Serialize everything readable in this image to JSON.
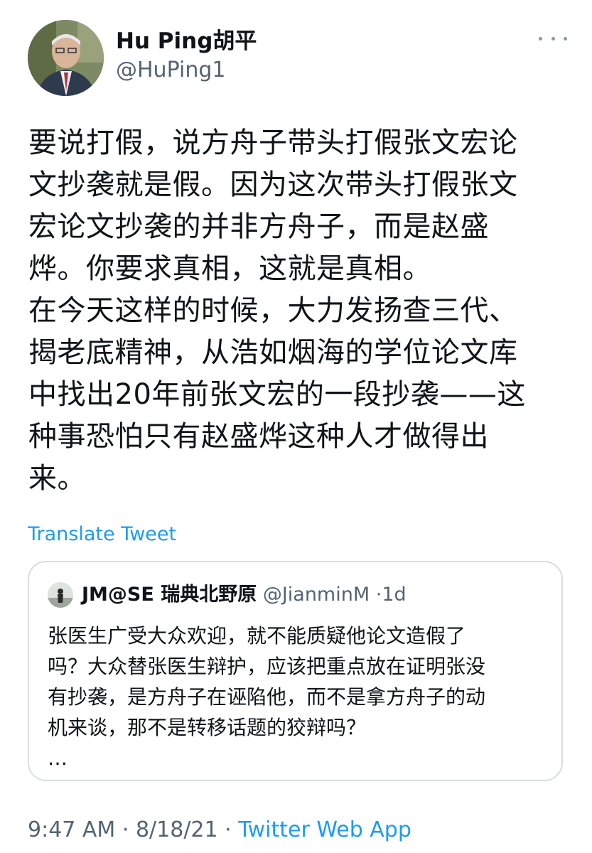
{
  "author": {
    "display_name": "Hu Ping胡平",
    "handle": "@HuPing1"
  },
  "tweet": {
    "text": "要说打假，说方舟子带头打假张文宏论\n文抄袭就是假。因为这次带头打假张文\n宏论文抄袭的并非方舟子，而是赵盛\n烨。你要求真相，这就是真相。\n在今天这样的时候，大力发扬查三代、\n揭老底精神，从浩如烟海的学位论文库\n中找出20年前张文宏的一段抄袭——这\n种事恐怕只有赵盛烨这种人才做得出\n来。",
    "translate_label": "Translate Tweet"
  },
  "quoted_tweet": {
    "display_name": "JM@SE 瑞典北野原",
    "handle": "@JianminM",
    "separator": "·",
    "time": "1d",
    "text": "张医生广受大众欢迎，就不能质疑他论文造假了\n吗？大众替张医生辩护，应该把重点放在证明张没\n有抄袭，是方舟子在诬陷他，而不是拿方舟子的动\n机来谈，那不是转移话题的狡辩吗？\n…"
  },
  "footer": {
    "time": "9:47 AM",
    "separator1": "·",
    "date": "8/18/21",
    "separator2": "·",
    "source": "Twitter Web App"
  },
  "colors": {
    "text": "#0f1419",
    "secondary": "#536471",
    "link": "#1d9bf0",
    "border": "#d8dde1"
  },
  "icons": {
    "more": "more-horizontal-icon"
  }
}
